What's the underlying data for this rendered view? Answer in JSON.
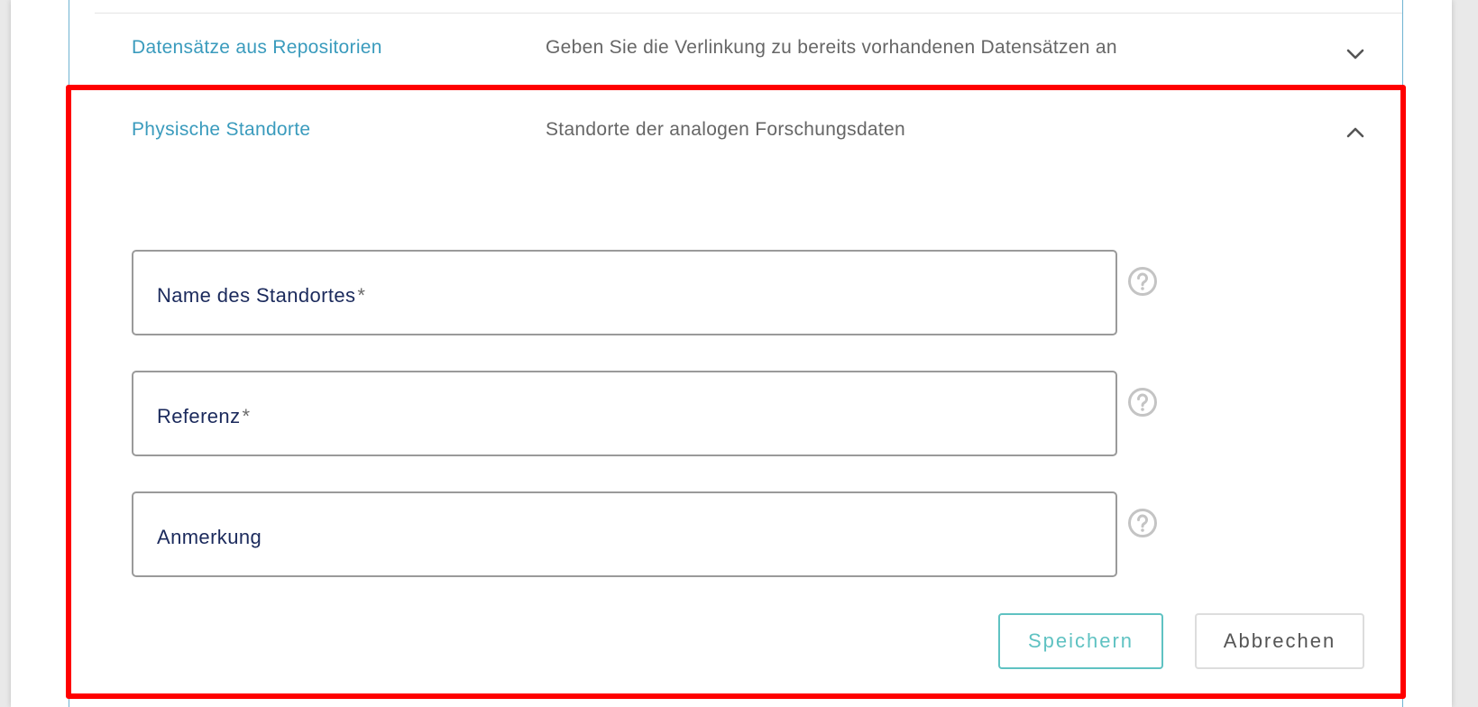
{
  "sections": [
    {
      "title": "Datensätze aus Repositorien",
      "description": "Geben Sie die Verlinkung zu bereits vorhandenen Datensätzen an",
      "expanded": false
    },
    {
      "title": "Physische Standorte",
      "description": "Standorte der analogen Forschungsdaten",
      "expanded": true
    }
  ],
  "form": {
    "fields": [
      {
        "label": "Name des Standortes",
        "required_mark": "*",
        "value": ""
      },
      {
        "label": "Referenz",
        "required_mark": "*",
        "value": ""
      },
      {
        "label": "Anmerkung",
        "required_mark": "",
        "value": ""
      }
    ],
    "save_label": "Speichern",
    "cancel_label": "Abbrechen"
  },
  "icons": {
    "expand": "chevron-down-icon",
    "collapse": "chevron-up-icon",
    "help": "help-circle-icon"
  },
  "colors": {
    "title": "#3a9bbd",
    "accent": "#5fc2c2",
    "highlight": "#ff0000",
    "label": "#1b2a5c"
  }
}
